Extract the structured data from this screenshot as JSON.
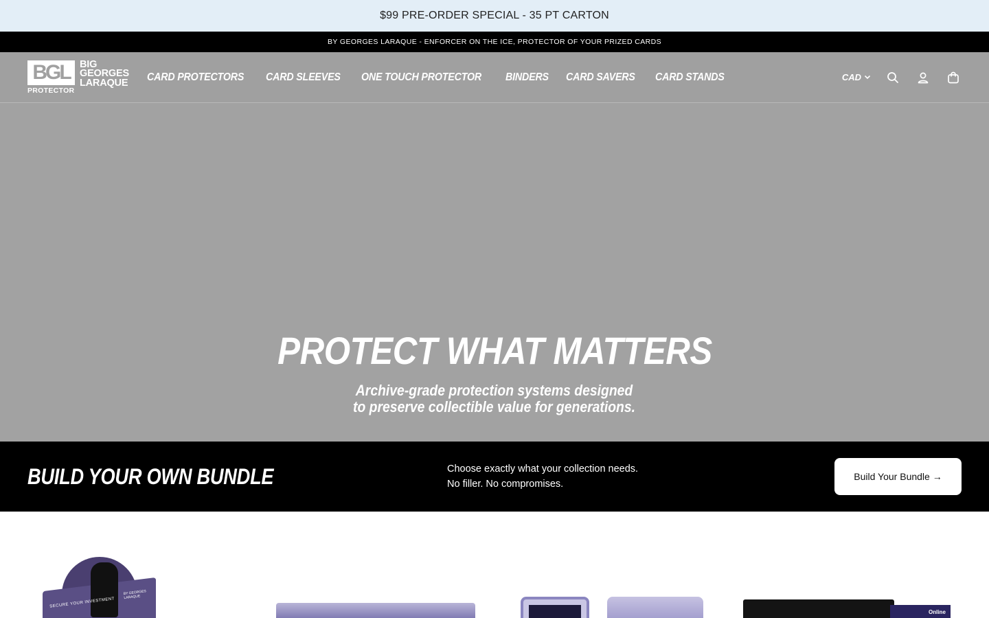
{
  "promo": {
    "text": "$99 PRE-ORDER SPECIAL - 35 PT CARTON"
  },
  "tagline": {
    "text": "BY GEORGES LARAQUE - ENFORCER ON THE ICE, PROTECTOR OF YOUR PRIZED CARDS"
  },
  "logo": {
    "mark": "BGL",
    "sub": "PROTECTOR",
    "line1": "BIG",
    "line2": "GEORGES",
    "line3": "LARAQUE"
  },
  "nav": {
    "items": [
      {
        "label": "CARD PROTECTORS"
      },
      {
        "label": "CARD SLEEVES"
      },
      {
        "label": "ONE TOUCH PROTECTOR"
      },
      {
        "label": "BINDERS"
      },
      {
        "label": "CARD SAVERS"
      },
      {
        "label": "CARD STANDS"
      }
    ]
  },
  "header_tools": {
    "currency": "CAD",
    "icons": [
      "chevron-down-icon",
      "search-icon",
      "account-icon",
      "cart-icon"
    ]
  },
  "hero": {
    "title": "PROTECT WHAT MATTERS",
    "subtitle_line1": "Archive-grade protection systems designed",
    "subtitle_line2": "to preserve collectible value for generations."
  },
  "bundle": {
    "title": "BUILD YOUR OWN BUNDLE",
    "text_line1": "Choose exactly what your collection needs.",
    "text_line2": "No filler. No compromises.",
    "button_label": "Build Your Bundle →"
  },
  "products": {
    "p1_label": "SECURE YOUR INVESTMENT",
    "p1_brand": "BY GEORGES LARAQUE",
    "p4_label": "Online"
  },
  "colors": {
    "promo_bg": "#e3eef7",
    "header_bg": "#a0a0a0",
    "hero_bg": "#a2a2a2",
    "bundle_bg": "#000000",
    "accent_purple": "#5a4f85"
  }
}
